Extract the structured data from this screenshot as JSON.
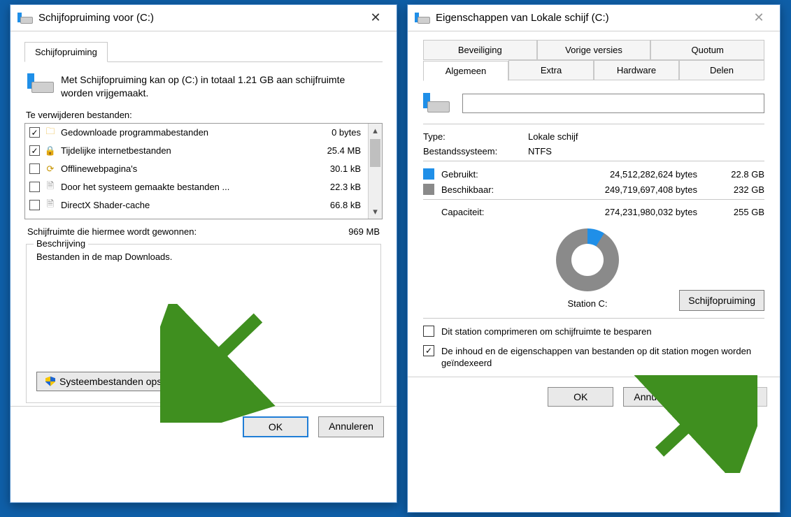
{
  "cleanup": {
    "title": "Schijfopruiming voor  (C:)",
    "tab": "Schijfopruiming",
    "intro": "Met Schijfopruiming kan op  (C:) in totaal 1.21 GB aan schijfruimte worden vrijgemaakt.",
    "list_label": "Te verwijderen bestanden:",
    "files": [
      {
        "checked": true,
        "icon": "folder",
        "name": "Gedownloade programmabestanden",
        "size": "0 bytes"
      },
      {
        "checked": true,
        "icon": "lock",
        "name": "Tijdelijke internetbestanden",
        "size": "25.4 MB"
      },
      {
        "checked": false,
        "icon": "refresh",
        "name": "Offlinewebpagina's",
        "size": "30.1 kB"
      },
      {
        "checked": false,
        "icon": "doc",
        "name": "Door het systeem gemaakte bestanden ...",
        "size": "22.3 kB"
      },
      {
        "checked": false,
        "icon": "doc",
        "name": "DirectX Shader-cache",
        "size": "66.8 kB"
      }
    ],
    "gain_label": "Schijfruimte die hiermee wordt gewonnen:",
    "gain_value": "969 MB",
    "desc_legend": "Beschrijving",
    "desc_text": "Bestanden in de map Downloads.",
    "sysclean": "Systeembestanden opschonen",
    "ok": "OK",
    "cancel": "Annuleren"
  },
  "props": {
    "title": "Eigenschappen van Lokale schijf (C:)",
    "tabs_top": [
      "Beveiliging",
      "Vorige versies",
      "Quotum"
    ],
    "tabs_bottom": [
      "Algemeen",
      "Extra",
      "Hardware",
      "Delen"
    ],
    "active_tab": "Algemeen",
    "name_value": "",
    "type_k": "Type:",
    "type_v": "Lokale schijf",
    "fs_k": "Bestandssysteem:",
    "fs_v": "NTFS",
    "used_label": "Gebruikt:",
    "used_bytes": "24,512,282,624 bytes",
    "used_gb": "22.8 GB",
    "free_label": "Beschikbaar:",
    "free_bytes": "249,719,697,408 bytes",
    "free_gb": "232 GB",
    "cap_label": "Capaciteit:",
    "cap_bytes": "274,231,980,032 bytes",
    "cap_gb": "255 GB",
    "station": "Station C:",
    "cleanup_btn": "Schijfopruiming",
    "compress": "Dit station comprimeren om schijfruimte te besparen",
    "index": "De inhoud en de eigenschappen van bestanden op dit station mogen worden geïndexeerd",
    "ok": "OK",
    "cancel": "Annuleren",
    "apply": "Toepassen"
  },
  "chart_data": {
    "type": "pie",
    "title": "Station C:",
    "categories": [
      "Gebruikt",
      "Beschikbaar"
    ],
    "values_bytes": [
      24512282624,
      249719697408
    ],
    "values_gb": [
      22.8,
      232
    ],
    "total_bytes": 274231980032,
    "total_gb": 255,
    "colors": [
      "#1f8fe8",
      "#8a8a8a"
    ]
  }
}
